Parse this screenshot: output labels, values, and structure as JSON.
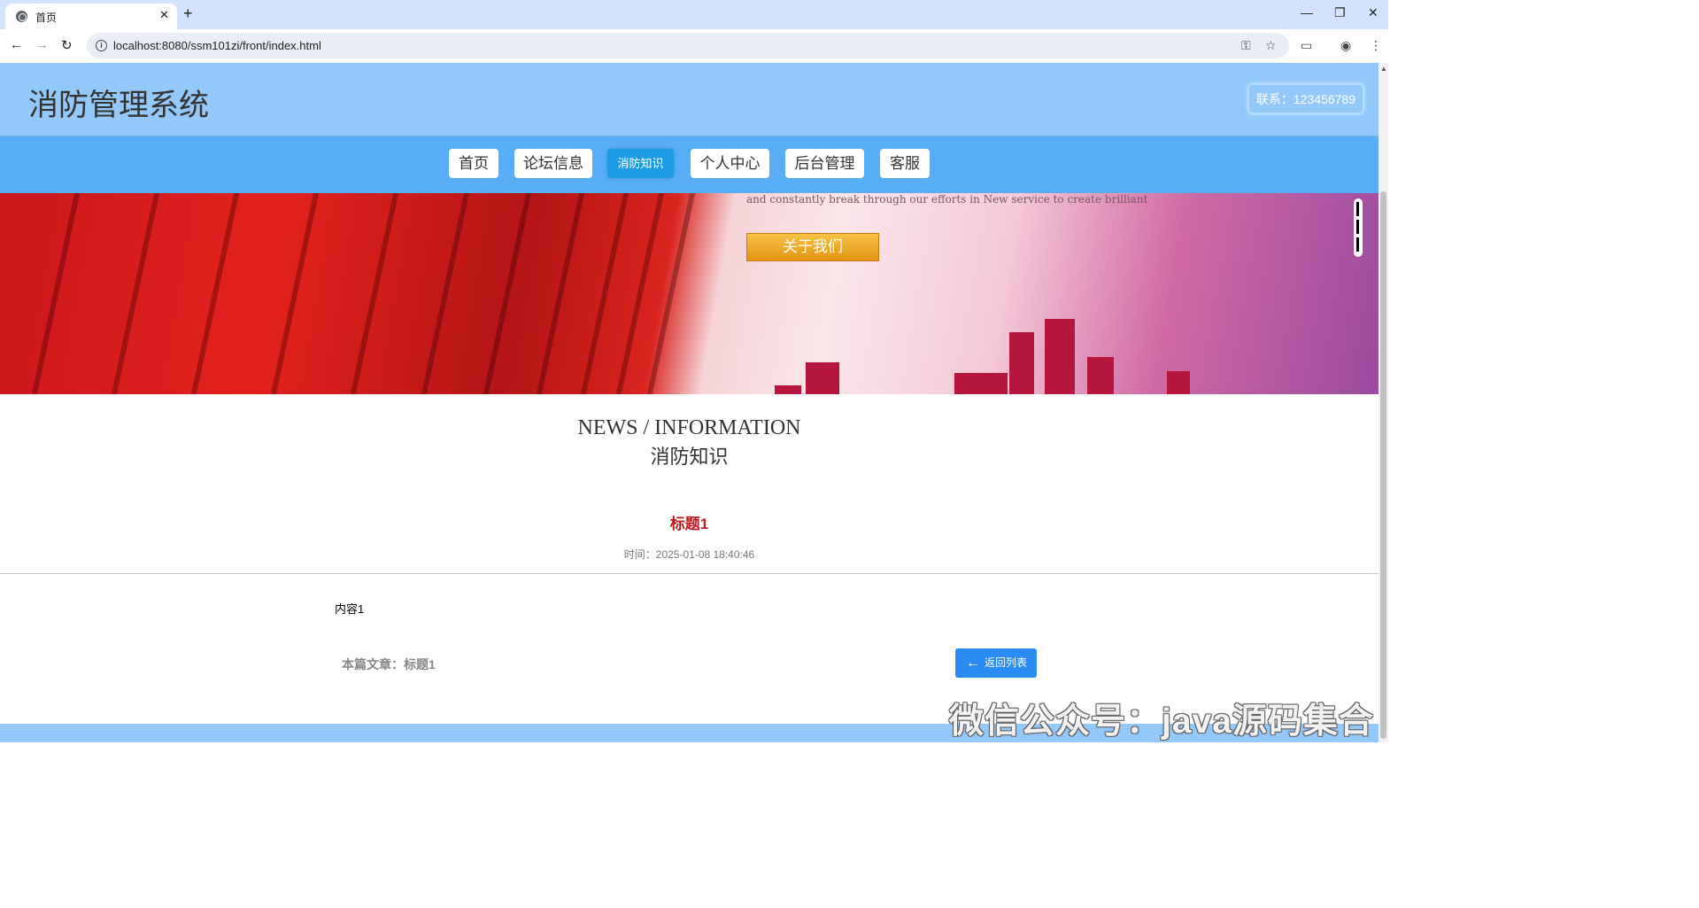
{
  "browser": {
    "tab_title": "首页",
    "tab_close": "✕",
    "new_tab": "+",
    "url": "localhost:8080/ssm101zi/front/index.html",
    "minimize": "—",
    "restore": "❐",
    "close": "✕"
  },
  "header": {
    "site_title": "消防管理系统",
    "contact": "联系：123456789"
  },
  "nav": {
    "items": [
      {
        "label": "首页"
      },
      {
        "label": "论坛信息"
      },
      {
        "label": "消防知识",
        "active": true
      },
      {
        "label": "个人中心"
      },
      {
        "label": "后台管理"
      },
      {
        "label": "客服"
      }
    ]
  },
  "banner": {
    "tagline": "and constantly break through our efforts in New service to create brilliant",
    "about_button": "关于我们"
  },
  "section": {
    "english_title": "NEWS / INFORMATION",
    "chinese_title": "消防知识"
  },
  "article": {
    "title": "标题1",
    "time": "时间：2025-01-08 18:40:46",
    "content": "内容1",
    "this_article": "本篇文章：标题1",
    "back_button": "返回列表"
  },
  "watermark": "微信公众号：java源码集合",
  "colors": {
    "header_bg": "#93c8fb",
    "nav_bg": "#58adf7",
    "nav_active": "#1c9ce3",
    "article_title": "#c0191c",
    "back_button": "#2a8bf2"
  }
}
